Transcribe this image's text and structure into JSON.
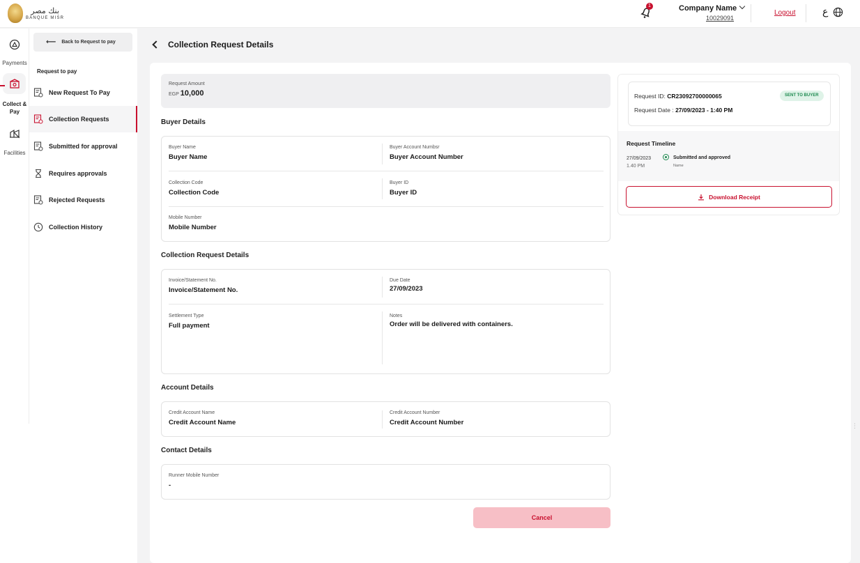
{
  "header": {
    "logo_arabic": "بنك مصر",
    "logo_english": "BANQUE MISR",
    "notification_count": "1",
    "company_name": "Company Name",
    "company_id": "10029091",
    "logout_label": "Logout",
    "language_toggle": "ع"
  },
  "rail": {
    "items": [
      {
        "label": "Payments",
        "icon": "payments-icon"
      },
      {
        "label": "Collect & Pay",
        "icon": "collect-pay-icon"
      },
      {
        "label": "Facilities",
        "icon": "facilities-icon"
      }
    ]
  },
  "sidebar": {
    "back_label": "Back to Request to pay",
    "heading": "Request to pay",
    "items": [
      {
        "label": "New Request To Pay",
        "icon": "document-add-icon",
        "active": false
      },
      {
        "label": "Collection Requests",
        "icon": "collection-requests-icon",
        "active": true
      },
      {
        "label": "Submitted for approval",
        "icon": "document-check-icon",
        "active": false
      },
      {
        "label": "Requires approvals",
        "icon": "hourglass-icon",
        "active": false
      },
      {
        "label": "Rejected Requests",
        "icon": "document-reject-icon",
        "active": false
      },
      {
        "label": "Collection History",
        "icon": "clock-icon",
        "active": false
      }
    ]
  },
  "page": {
    "title": "Collection Request Details",
    "amount_label": "Request Amount",
    "amount_currency": "EGP",
    "amount_value": "10,000"
  },
  "buyer": {
    "section_title": "Buyer Details",
    "buyer_name_label": "Buyer Name",
    "buyer_name_value": "Buyer Name",
    "buyer_account_label": "Buyer Account Numbsr",
    "buyer_account_value": "Buyer Account Number",
    "collection_code_label": "Collection Code",
    "collection_code_value": "Collection Code",
    "buyer_id_label": "Buyer ID",
    "buyer_id_value": "Buyer ID",
    "mobile_label": "Mobile Number",
    "mobile_value": "Mobile Number"
  },
  "collection": {
    "section_title": "Collection Request Details",
    "invoice_label": "Invoice/Statement No.",
    "invoice_value": "Invoice/Statement No.",
    "due_date_label": "Due Date",
    "due_date_value": "27/09/2023",
    "settlement_label": "Settlement Type",
    "settlement_value": "Full payment",
    "notes_label": "Notes",
    "notes_value": "Order will be delivered with containers."
  },
  "account": {
    "section_title": "Account Details",
    "credit_name_label": "Credit Account Name",
    "credit_name_value": "Credit Account Name",
    "credit_number_label": "Credit Account Number",
    "credit_number_value": "Credit Account Number"
  },
  "contact": {
    "section_title": "Contact Details",
    "runner_label": "Runner Mobile Number",
    "runner_value": "-"
  },
  "request_info": {
    "id_label": "Request ID:",
    "id_value": "CR23092700000065",
    "date_label": "Request Date :",
    "date_value": "27/09/2023 - 1:40 PM",
    "status_badge": "SENT TO BUYER",
    "status_color": "#1e8a4f",
    "timeline_title": "Request Timeline",
    "timeline": [
      {
        "date": "27/09/2023",
        "time": "1.40 PM",
        "event": "Submitted and approved",
        "by": "Name"
      }
    ],
    "download_label": "Download Receipt"
  },
  "actions": {
    "cancel_label": "Cancel"
  },
  "theme": {
    "brand_color": "#c8102e"
  }
}
